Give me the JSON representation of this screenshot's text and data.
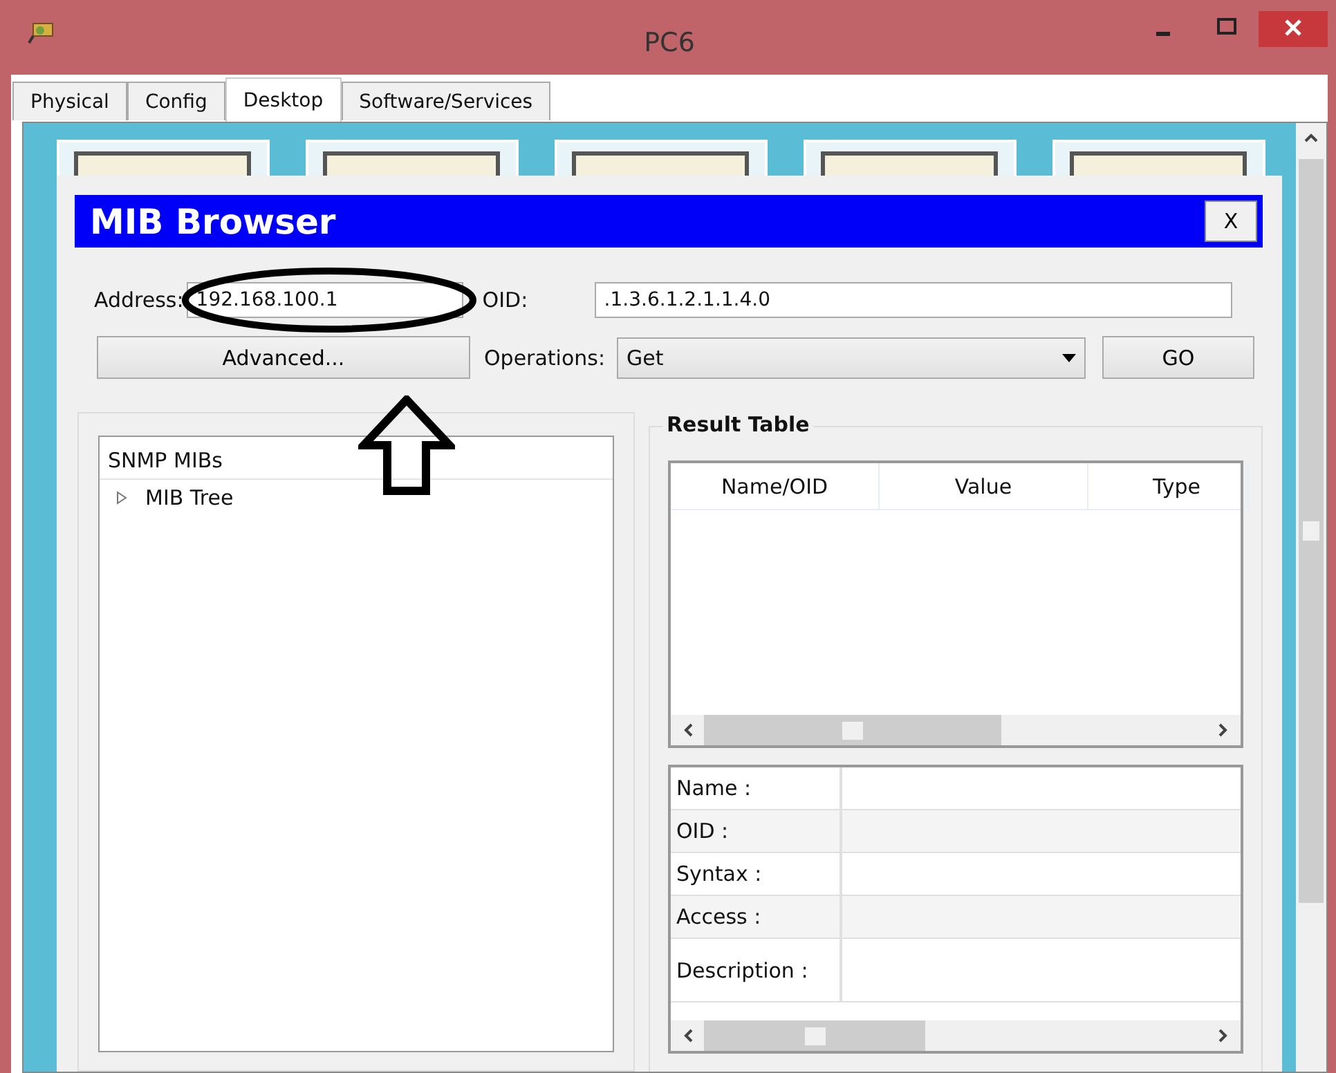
{
  "window": {
    "title": "PC6"
  },
  "tabs": [
    {
      "label": "Physical",
      "selected": false
    },
    {
      "label": "Config",
      "selected": false
    },
    {
      "label": "Desktop",
      "selected": true
    },
    {
      "label": "Software/Services",
      "selected": false
    }
  ],
  "dialog": {
    "title": "MIB Browser",
    "close": "X",
    "address_label": "Address:",
    "address": "192.168.100.1",
    "oid_label": "OID:",
    "oid": ".1.3.6.1.2.1.1.4.0",
    "advanced_button": "Advanced...",
    "operations_label": "Operations:",
    "operation": "Get",
    "go_button": "GO",
    "tree": {
      "header": "SNMP MIBs",
      "items": [
        {
          "label": "MIB Tree",
          "expanded": false
        }
      ]
    },
    "result_table": {
      "title": "Result Table",
      "columns": [
        "Name/OID",
        "Value",
        "Type"
      ]
    },
    "details": [
      "Name :",
      "OID :",
      "Syntax :",
      "Access :",
      "Description :"
    ]
  }
}
